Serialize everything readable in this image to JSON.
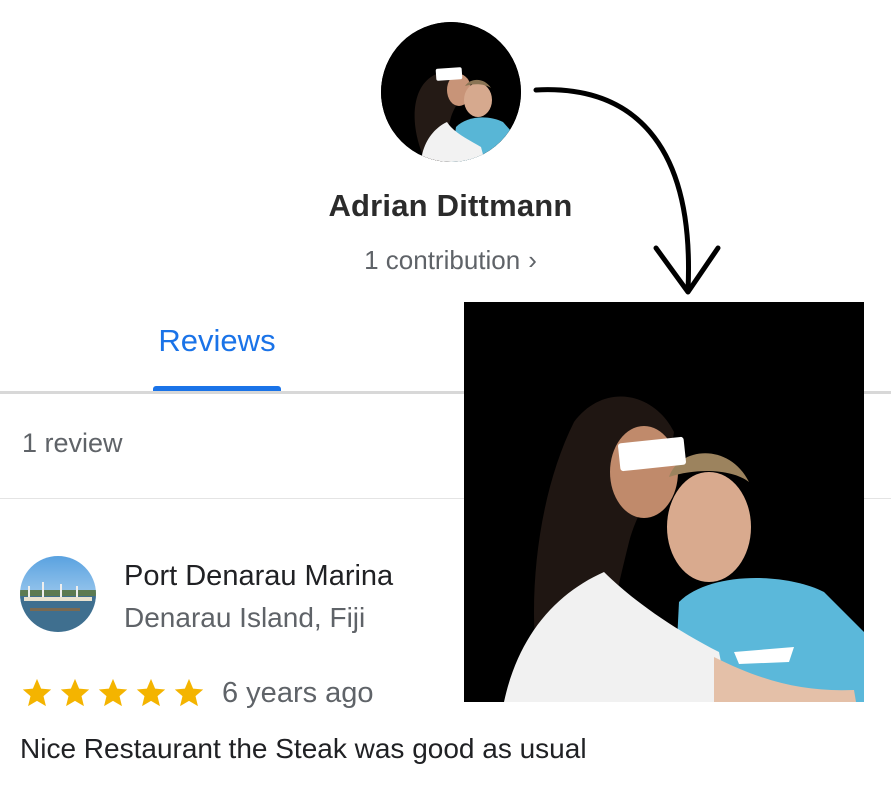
{
  "profile": {
    "name": "Adrian Dittmann",
    "contributions": "1 contribution",
    "chevron": "›"
  },
  "tabs": [
    {
      "label": "Reviews",
      "active": true
    }
  ],
  "review_count": "1 review",
  "review": {
    "place_name": "Port Denarau Marina",
    "place_location": "Denarau Island, Fiji",
    "rating": 5,
    "time": "6 years ago",
    "text": "Nice Restaurant the Steak was good as usual"
  },
  "colors": {
    "accent": "#1a73e8",
    "star": "#f4b400",
    "secondary_text": "#5f6368"
  },
  "icons": [
    "chevron-right-icon",
    "star-icon",
    "curved-arrow-icon"
  ]
}
